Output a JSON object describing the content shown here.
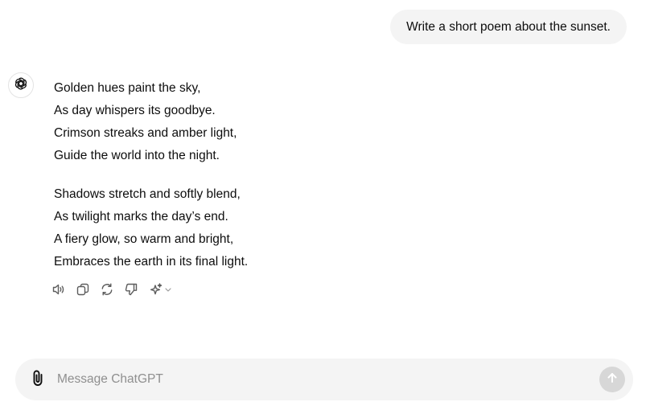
{
  "conversation": {
    "user_message": "Write a short poem about the sunset.",
    "assistant": {
      "avatar_icon": "chatgpt-logo-icon",
      "stanzas": [
        {
          "lines": [
            "Golden hues paint the sky,",
            "As day whispers its goodbye.",
            "Crimson streaks and amber light,",
            "Guide the world into the night."
          ]
        },
        {
          "lines": [
            "Shadows stretch and softly blend,",
            "As twilight marks the day’s end.",
            "A fiery glow, so warm and bright,",
            "Embraces the earth in its final light."
          ]
        }
      ],
      "actions": [
        {
          "icon": "speaker-icon",
          "name": "read-aloud-button"
        },
        {
          "icon": "copy-icon",
          "name": "copy-button"
        },
        {
          "icon": "regenerate-icon",
          "name": "regenerate-button"
        },
        {
          "icon": "thumbs-down-icon",
          "name": "bad-response-button"
        },
        {
          "icon": "sparkle-icon",
          "name": "change-model-button"
        }
      ]
    }
  },
  "composer": {
    "placeholder": "Message ChatGPT",
    "value": "",
    "attach_icon": "paperclip-icon",
    "send_icon": "arrow-up-icon"
  },
  "colors": {
    "user_bubble_bg": "#f4f4f4",
    "composer_bg": "#f4f4f4",
    "send_disabled_bg": "#d7d7d7",
    "text": "#0d0d0d",
    "placeholder": "#8f8f8f"
  }
}
